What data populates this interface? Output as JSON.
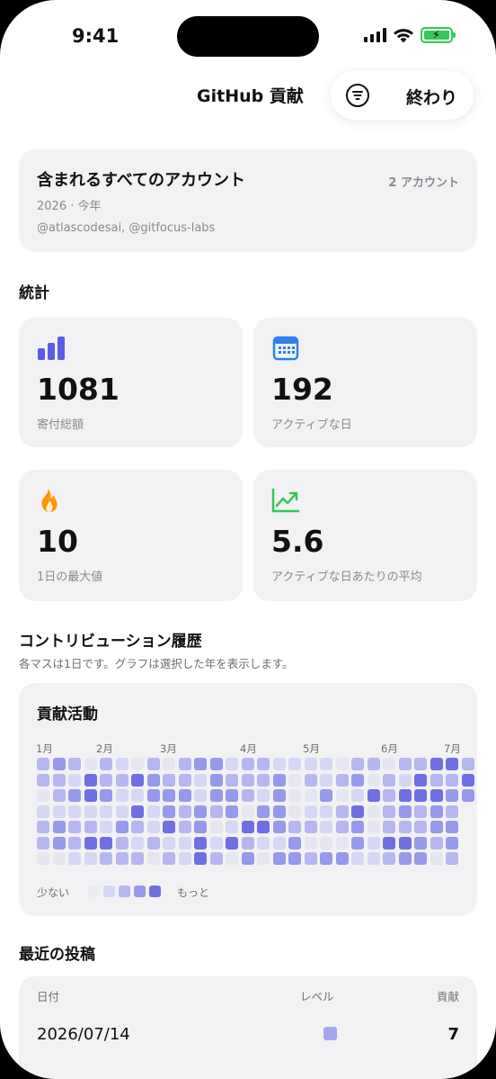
{
  "status": {
    "time": "9:41"
  },
  "nav": {
    "title": "GitHub 貢献",
    "done_label": "終わり"
  },
  "accounts": {
    "title": "含まれるすべてのアカウント",
    "count": "2 アカウント",
    "year": "2026 · 今年",
    "names": "@atlascodesai, @gitfocus-labs"
  },
  "stats": {
    "title": "統計",
    "items": [
      {
        "icon": "bar-chart-icon",
        "value": "1081",
        "label": "寄付総額",
        "color": "#5b5be6"
      },
      {
        "icon": "calendar-icon",
        "value": "192",
        "label": "アクティブな日",
        "color": "#2f80ed"
      },
      {
        "icon": "flame-icon",
        "value": "10",
        "label": "1日の最大値",
        "color": "#ff9500"
      },
      {
        "icon": "trend-up-icon",
        "value": "5.6",
        "label": "アクティブな日あたりの平均",
        "color": "#34c759"
      }
    ]
  },
  "history": {
    "title": "コントリビューション履歴",
    "subtitle": "各マスは1日です。グラフは選択した年を表示します。"
  },
  "heatmap": {
    "title": "貢献活動",
    "months": [
      "1月",
      "2月",
      "3月",
      "4月",
      "5月",
      "6月",
      "7月"
    ],
    "legend_low": "少ない",
    "legend_high": "もっと",
    "colors": [
      "#e6e6f0",
      "#d6d6f5",
      "#b6b6f1",
      "#9898ec",
      "#6f6fe3"
    ]
  },
  "recent": {
    "title": "最近の投稿",
    "headers": {
      "date": "日付",
      "level": "レベル",
      "contributions": "貢献"
    },
    "rows": [
      {
        "date": "2026/07/14",
        "value": "7"
      }
    ]
  }
}
